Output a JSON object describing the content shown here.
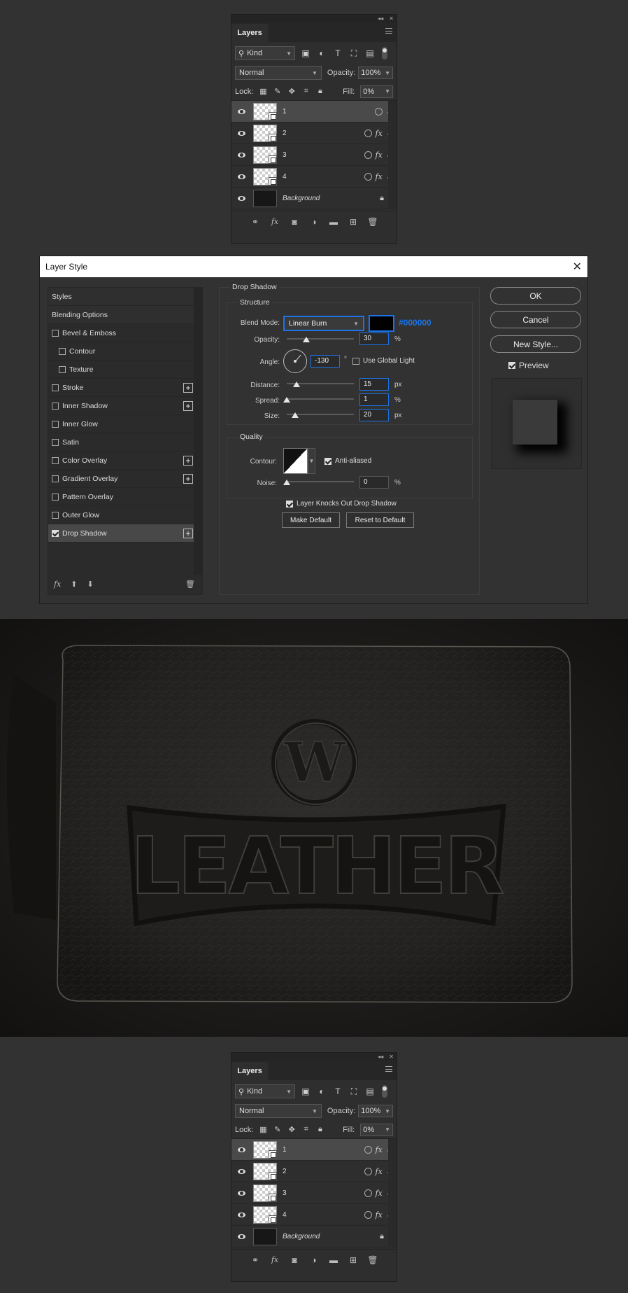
{
  "layers_panel": {
    "tab_label": "Layers",
    "kind_filter": "Kind",
    "blend_mode": "Normal",
    "opacity_label": "Opacity:",
    "opacity_value": "100%",
    "lock_label": "Lock:",
    "fill_label": "Fill:",
    "fill_value": "0%",
    "layers": [
      {
        "name": "1",
        "italic": false
      },
      {
        "name": "2",
        "italic": false
      },
      {
        "name": "3",
        "italic": false
      },
      {
        "name": "4",
        "italic": false
      },
      {
        "name": "Background",
        "italic": true
      }
    ]
  },
  "layer_style_dialog": {
    "title": "Layer Style",
    "styles_list": [
      {
        "label": "Styles"
      },
      {
        "label": "Blending Options"
      },
      {
        "label": "Bevel & Emboss"
      },
      {
        "label": "Contour"
      },
      {
        "label": "Texture"
      },
      {
        "label": "Stroke"
      },
      {
        "label": "Inner Shadow"
      },
      {
        "label": "Inner Glow"
      },
      {
        "label": "Satin"
      },
      {
        "label": "Color Overlay"
      },
      {
        "label": "Gradient Overlay"
      },
      {
        "label": "Pattern Overlay"
      },
      {
        "label": "Outer Glow"
      },
      {
        "label": "Drop Shadow"
      }
    ],
    "section_title": "Drop Shadow",
    "structure_title": "Structure",
    "blend_mode_label": "Blend Mode:",
    "blend_mode_value": "Linear Burn",
    "shadow_color": "#000000",
    "shadow_color_label": "#000000",
    "opacity_label": "Opacity:",
    "opacity_value": "30",
    "opacity_unit": "%",
    "angle_label": "Angle:",
    "angle_value": "-130",
    "angle_unit": "°",
    "use_global_light": "Use Global Light",
    "distance_label": "Distance:",
    "distance_value": "15",
    "distance_unit": "px",
    "spread_label": "Spread:",
    "spread_value": "1",
    "spread_unit": "%",
    "size_label": "Size:",
    "size_value": "20",
    "size_unit": "px",
    "quality_title": "Quality",
    "contour_label": "Contour:",
    "anti_aliased": "Anti-aliased",
    "noise_label": "Noise:",
    "noise_value": "0",
    "noise_unit": "%",
    "knocks_out": "Layer Knocks Out Drop Shadow",
    "make_default": "Make Default",
    "reset_default": "Reset to Default",
    "ok": "OK",
    "cancel": "Cancel",
    "new_style": "New Style...",
    "preview": "Preview"
  },
  "photo": {
    "emblem_letter": "W",
    "word": "LEATHER"
  },
  "colors": {
    "accent": "#1a73e8",
    "panel_bg": "#2e2e2e",
    "app_bg": "#323232"
  }
}
